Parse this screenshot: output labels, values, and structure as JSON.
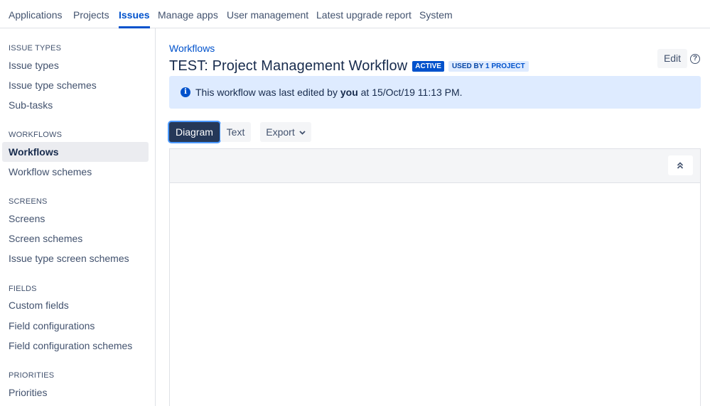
{
  "topnav": {
    "tabs": [
      {
        "label": "Applications",
        "active": false
      },
      {
        "label": "Projects",
        "active": false
      },
      {
        "label": "Issues",
        "active": true
      },
      {
        "label": "Manage apps",
        "active": false
      },
      {
        "label": "User management",
        "active": false
      },
      {
        "label": "Latest upgrade report",
        "active": false
      },
      {
        "label": "System",
        "active": false
      }
    ]
  },
  "sidebar": {
    "issue_types": {
      "heading": "ISSUE TYPES",
      "items": [
        "Issue types",
        "Issue type schemes",
        "Sub-tasks"
      ]
    },
    "workflows": {
      "heading": "WORKFLOWS",
      "items": [
        "Workflows",
        "Workflow schemes"
      ],
      "active_index": 0
    },
    "screens": {
      "heading": "SCREENS",
      "items": [
        "Screens",
        "Screen schemes",
        "Issue type screen schemes"
      ]
    },
    "fields": {
      "heading": "FIELDS",
      "items": [
        "Custom fields",
        "Field configurations",
        "Field configuration schemes"
      ]
    },
    "priorities": {
      "heading": "PRIORITIES",
      "items": [
        "Priorities"
      ]
    }
  },
  "main": {
    "breadcrumb": "Workflows",
    "title": "TEST: Project Management Workflow",
    "status_badge": "ACTIVE",
    "usage_badge_prefix": "USED BY ",
    "usage_badge_link": "1 PROJECT",
    "edit_label": "Edit",
    "help_glyph": "?",
    "info": {
      "prefix": "This workflow was last edited by ",
      "user": "you",
      "suffix": " at 15/Oct/19 11:13 PM."
    },
    "view_buttons": {
      "diagram": "Diagram",
      "text": "Text",
      "export": "Export"
    }
  },
  "icons": {
    "info": "info-icon",
    "help": "question-circle-icon",
    "chevron": "chevron-down-icon",
    "collapse": "double-chevron-up-icon"
  },
  "colors": {
    "accent": "#0052cc",
    "banner": "#deebff",
    "primary_button": "#253858"
  }
}
